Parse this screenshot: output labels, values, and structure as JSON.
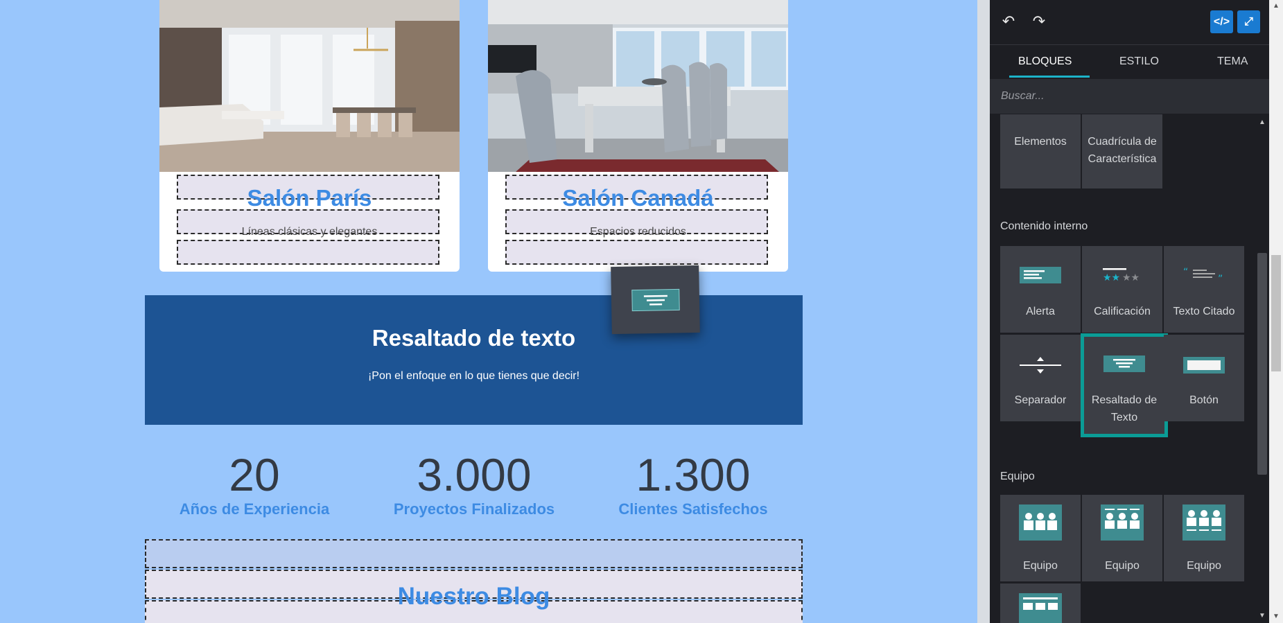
{
  "canvas": {
    "cards": [
      {
        "title": "Salón París",
        "subtitle": "Líneas clásicas y elegantes"
      },
      {
        "title": "Salón Canadá",
        "subtitle": "Espacios reducidos"
      }
    ],
    "highlight": {
      "title": "Resaltado de texto",
      "text": "¡Pon el enfoque en lo que tienes que decir!"
    },
    "stats": [
      {
        "number": "20",
        "label": "Años de Experiencia"
      },
      {
        "number": "3.000",
        "label": "Proyectos Finalizados"
      },
      {
        "number": "1.300",
        "label": "Clientes Satisfechos"
      }
    ],
    "blog_title": "Nuestro Blog"
  },
  "sidebar": {
    "toolbar": {
      "undo_icon": "undo-icon",
      "redo_icon": "redo-icon",
      "code_icon": "code-icon",
      "fullscreen_icon": "expand-icon"
    },
    "tabs": [
      {
        "label": "BLOQUES",
        "active": true
      },
      {
        "label": "ESTILO",
        "active": false
      },
      {
        "label": "TEMA",
        "active": false
      }
    ],
    "search_placeholder": "Buscar...",
    "top_tiles": [
      {
        "label": "Elementos"
      },
      {
        "label": "Cuadrícula de Característica"
      }
    ],
    "sections": [
      {
        "title": "Contenido interno",
        "tiles": [
          {
            "label": "Alerta"
          },
          {
            "label": "Calificación"
          },
          {
            "label": "Texto Citado"
          },
          {
            "label": "Separador"
          },
          {
            "label": "Resaltado de Texto",
            "selected": true
          },
          {
            "label": "Botón"
          }
        ]
      },
      {
        "title": "Equipo",
        "tiles": [
          {
            "label": "Equipo"
          },
          {
            "label": "Equipo"
          },
          {
            "label": "Equipo"
          }
        ]
      }
    ]
  },
  "colors": {
    "canvas_bg": "#99c6fc",
    "accent_blue": "#3d8be3",
    "highlight_bg": "#1d5494",
    "sidebar_bg": "#1d1e23",
    "tile_bg": "#3c3e45",
    "selection": "#0b9c96",
    "tab_underline": "#1cb3c9",
    "toolbar_button": "#1a7bd1"
  }
}
